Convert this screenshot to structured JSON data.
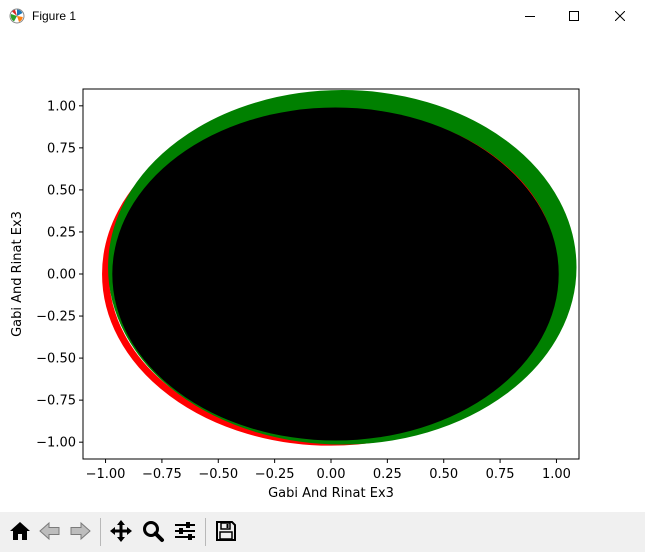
{
  "window": {
    "title": "Figure 1"
  },
  "toolbar": {
    "buttons": [
      {
        "name": "home-button",
        "icon": "home-icon"
      },
      {
        "name": "back-button",
        "icon": "arrow-left-icon"
      },
      {
        "name": "forward-button",
        "icon": "arrow-right-icon"
      },
      {
        "name": "pan-button",
        "icon": "move-icon"
      },
      {
        "name": "zoom-button",
        "icon": "magnifier-icon"
      },
      {
        "name": "configure-subplots-button",
        "icon": "sliders-icon"
      },
      {
        "name": "save-button",
        "icon": "floppy-disk-icon"
      }
    ]
  },
  "chart_data": {
    "type": "scatter",
    "xlabel": "Gabi And Rinat Ex3",
    "ylabel": "Gabi And Rinat Ex3",
    "xlim": [
      -1.1,
      1.1
    ],
    "ylim": [
      -1.1,
      1.1
    ],
    "xticks": [
      "−1.00",
      "−0.75",
      "−0.50",
      "−0.25",
      "0.00",
      "0.25",
      "0.50",
      "0.75",
      "1.00"
    ],
    "yticks": [
      "1.00",
      "0.75",
      "0.50",
      "0.25",
      "0.00",
      "−0.25",
      "−0.50",
      "−0.75",
      "−1.00"
    ],
    "xtick_values": [
      -1.0,
      -0.75,
      -0.5,
      -0.25,
      0.0,
      0.25,
      0.5,
      0.75,
      1.0
    ],
    "ytick_values": [
      1.0,
      0.75,
      0.5,
      0.25,
      0.0,
      -0.25,
      -0.5,
      -0.75,
      -1.0
    ],
    "grid": false,
    "series": [
      {
        "color": "#ff0000",
        "shape": "ring",
        "center": [
          0.0,
          0.0
        ],
        "radius": 1.0
      },
      {
        "color": "#000000",
        "shape": "filled disk",
        "center": [
          0.02,
          0.0
        ],
        "radius": 0.99
      },
      {
        "color": "#008000",
        "shape": "ring",
        "center": [
          0.05,
          0.04
        ],
        "radius_outer": 1.03,
        "radius_inner": 0.96
      }
    ]
  }
}
